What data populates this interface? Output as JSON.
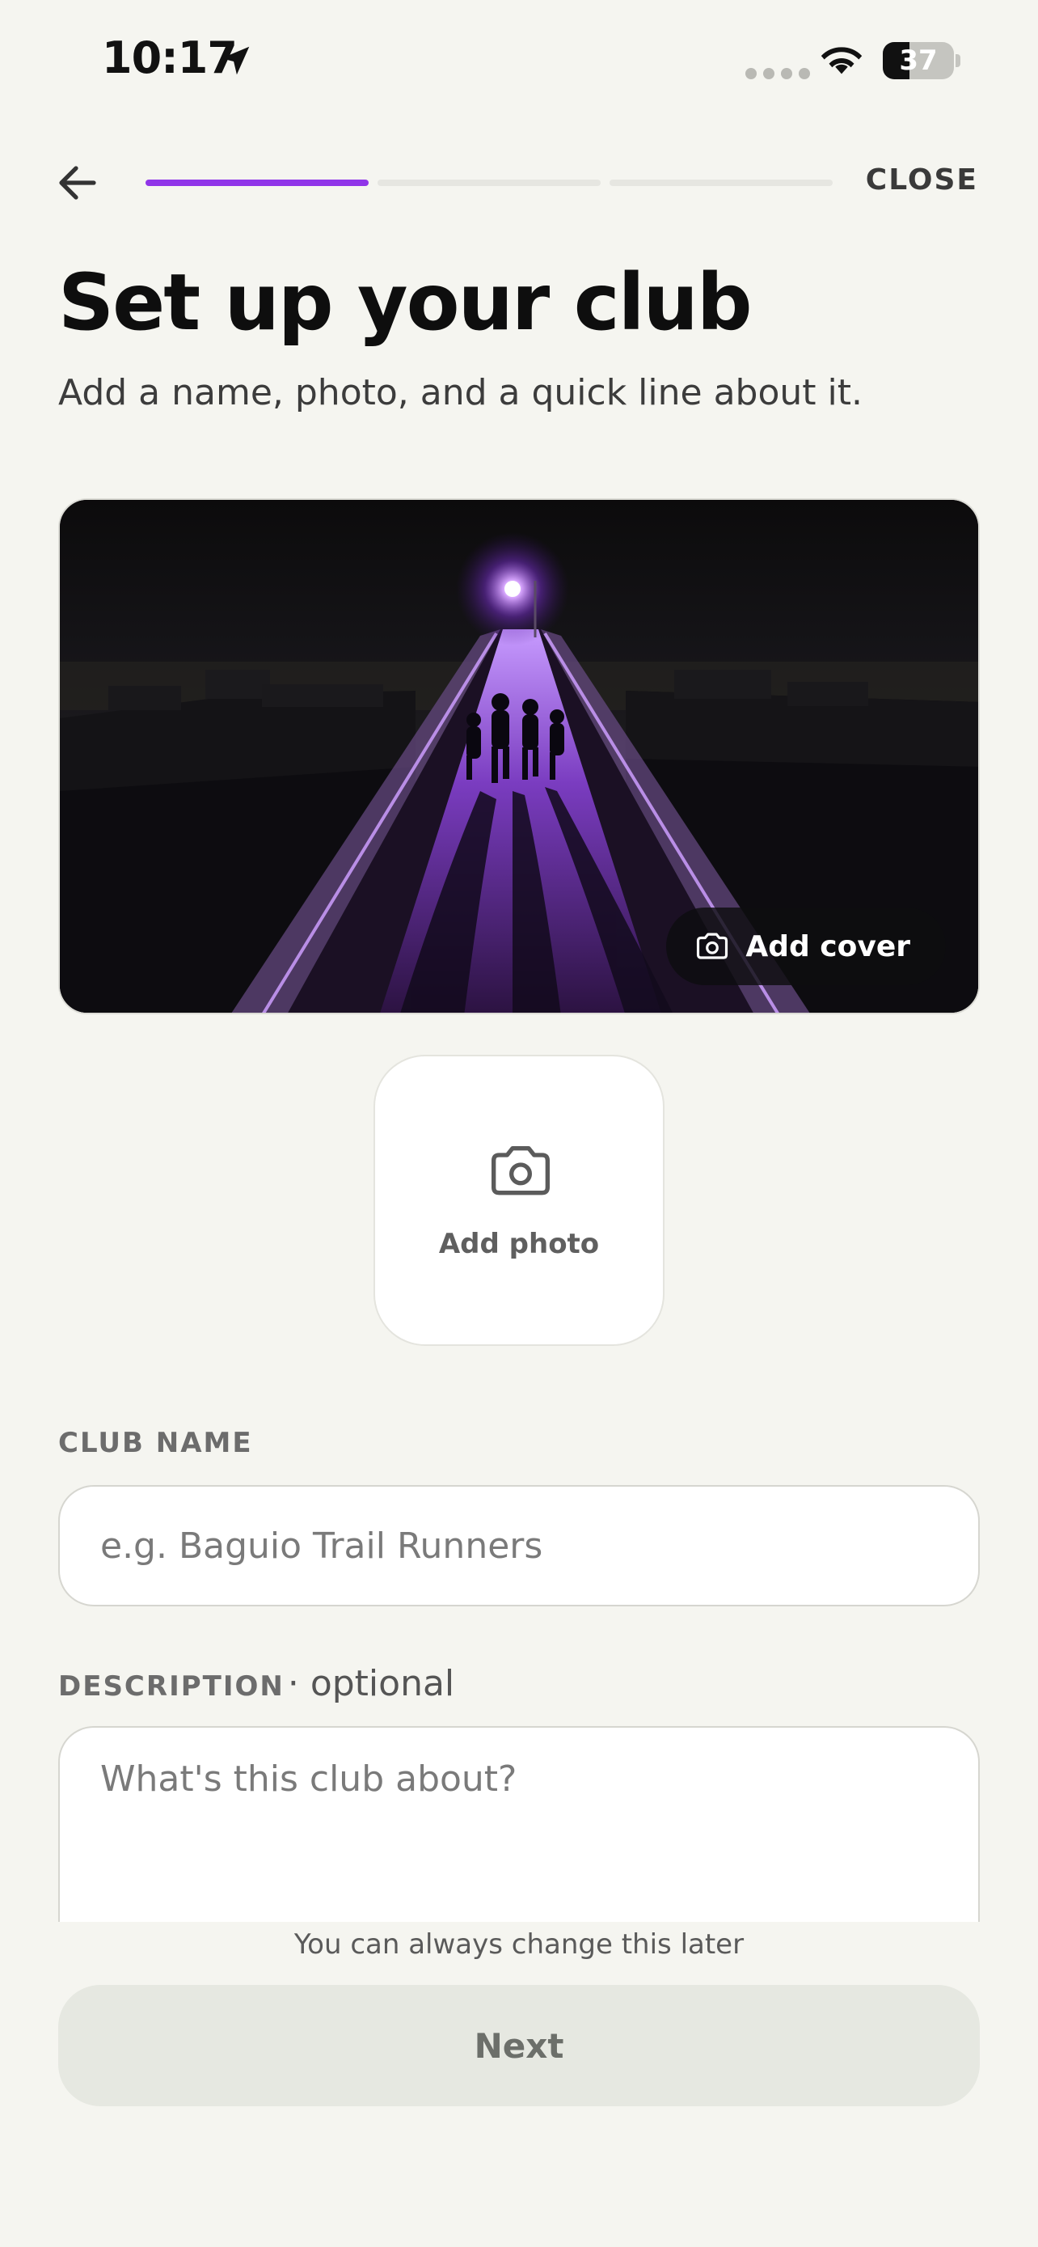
{
  "status_bar": {
    "time": "10:17",
    "battery": "37",
    "battery_level": 0.37
  },
  "nav": {
    "close_label": "CLOSE",
    "progress": {
      "steps": 3,
      "current": 1,
      "accent_color": "#9035e8"
    }
  },
  "header": {
    "title": "Set up your club",
    "subtitle": "Add a name, photo, and a quick line about it."
  },
  "cover": {
    "add_cover_label": "Add cover",
    "icon": "camera-icon"
  },
  "photo": {
    "add_photo_label": "Add photo",
    "icon": "camera-icon"
  },
  "form": {
    "club_name": {
      "label": "CLUB NAME",
      "placeholder": "e.g. Baguio Trail Runners",
      "value": ""
    },
    "description": {
      "label": "DESCRIPTION",
      "optional_tag": "· optional",
      "placeholder": "What's this club about?",
      "value": ""
    }
  },
  "footer": {
    "note": "You can always change this later",
    "next_label": "Next"
  }
}
